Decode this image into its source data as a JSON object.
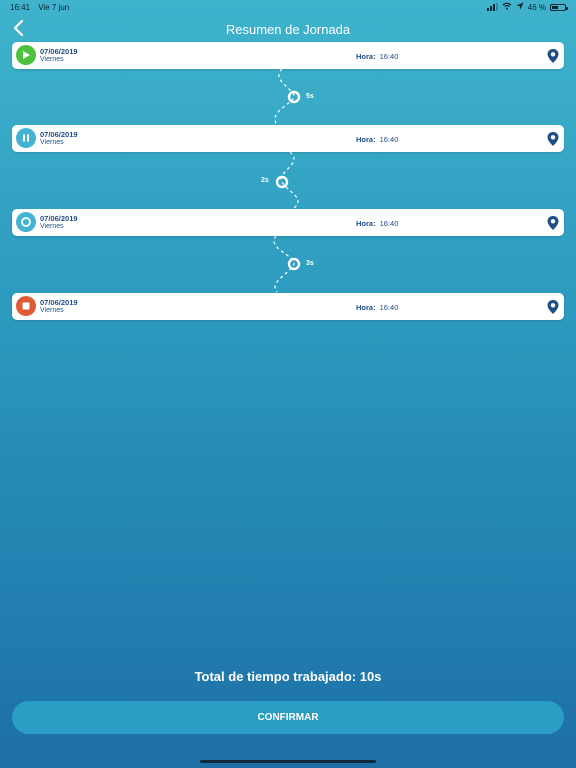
{
  "status_bar": {
    "time": "16:41",
    "date": "Vie 7 jun",
    "battery": "46 %",
    "battery_level": 0.46,
    "icons": [
      "signal-icon",
      "wifi-icon",
      "location-arrow-icon",
      "battery-icon"
    ]
  },
  "header": {
    "title": "Resumen de Jornada",
    "back_icon": "chevron-left-icon"
  },
  "events": [
    {
      "date": "07/06/2019",
      "day": "Viernes",
      "time_label": "Hora:",
      "time": "16:40",
      "icon": "play-icon",
      "color": "#4cc23f"
    },
    {
      "date": "07/06/2019",
      "day": "Viernes",
      "time_label": "Hora:",
      "time": "16:40",
      "icon": "pause-icon",
      "color": "#43b3d3"
    },
    {
      "date": "07/06/2019",
      "day": "Viernes",
      "time_label": "Hora:",
      "time": "16:40",
      "icon": "resume-icon",
      "color": "#43b3d3"
    },
    {
      "date": "07/06/2019",
      "day": "Viernes",
      "time_label": "Hora:",
      "time": "16:40",
      "icon": "stop-icon",
      "color": "#df5a37"
    }
  ],
  "durations": [
    "5s",
    "2s",
    "3s"
  ],
  "total": "Total de tiempo trabajado: 10s",
  "confirm_label": "CONFIRMAR",
  "colors": {
    "accent": "#1e4f86",
    "background_top": "#3fb3cc",
    "background_bottom": "#1d6fa6",
    "button": "#2a9dc4"
  }
}
